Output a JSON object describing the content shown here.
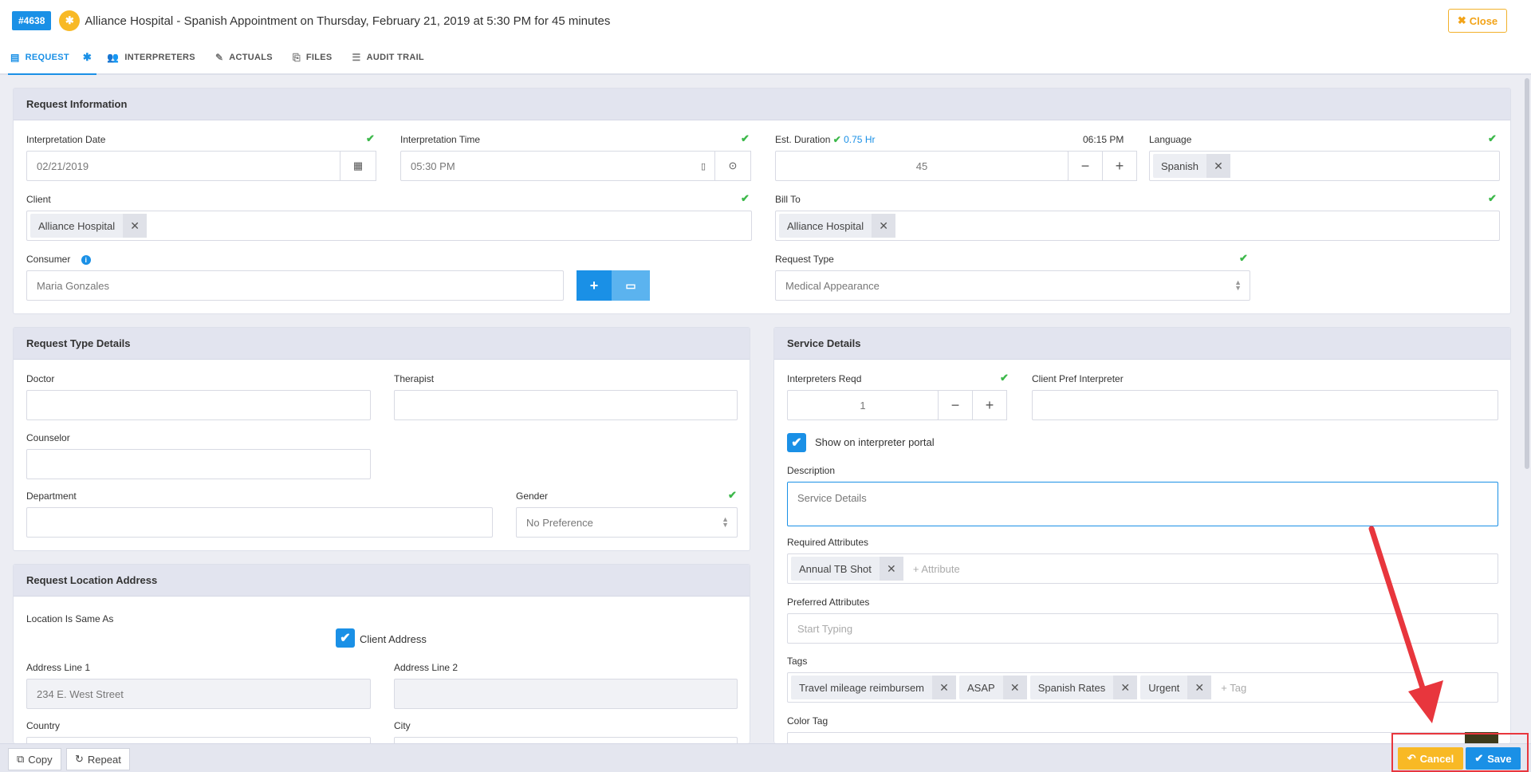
{
  "header": {
    "request_number": "#4638",
    "title": "Alliance Hospital  - Spanish Appointment on Thursday, February 21, 2019 at 5:30 PM for 45 minutes",
    "close_label": "Close"
  },
  "tabs": [
    {
      "label": "REQUEST",
      "icon": "form-icon"
    },
    {
      "label": "INTERPRETERS",
      "icon": "users-icon"
    },
    {
      "label": "ACTUALS",
      "icon": "edit-icon"
    },
    {
      "label": "FILES",
      "icon": "files-icon"
    },
    {
      "label": "AUDIT TRAIL",
      "icon": "list-icon"
    }
  ],
  "request_info": {
    "heading": "Request Information",
    "interpretation_date": {
      "label": "Interpretation Date",
      "value": "02/21/2019"
    },
    "interpretation_time": {
      "label": "Interpretation Time",
      "value": "05:30 PM"
    },
    "est_duration": {
      "label": "Est. Duration",
      "hours": "0.75 Hr",
      "end_time": "06:15 PM",
      "value": "45"
    },
    "language": {
      "label": "Language",
      "value": "Spanish"
    },
    "client": {
      "label": "Client",
      "value": "Alliance Hospital"
    },
    "bill_to": {
      "label": "Bill To",
      "value": "Alliance Hospital"
    },
    "consumer": {
      "label": "Consumer",
      "placeholder": "Maria Gonzales"
    },
    "request_type": {
      "label": "Request Type",
      "value": "Medical Appearance"
    }
  },
  "request_type_details": {
    "heading": "Request Type Details",
    "doctor_label": "Doctor",
    "therapist_label": "Therapist",
    "counselor_label": "Counselor",
    "department_label": "Department",
    "gender": {
      "label": "Gender",
      "value": "No Preference"
    }
  },
  "location": {
    "heading": "Request Location Address",
    "same_as_label": "Location Is Same As",
    "client_address_label": "Client Address",
    "address1": {
      "label": "Address Line 1",
      "value": "234 E. West Street"
    },
    "address2": {
      "label": "Address Line 2",
      "value": ""
    },
    "country_label": "Country",
    "city_label": "City"
  },
  "service_details": {
    "heading": "Service Details",
    "interpreters_reqd": {
      "label": "Interpreters Reqd",
      "value": "1"
    },
    "client_pref_label": "Client Pref Interpreter",
    "show_portal_label": "Show on interpreter portal",
    "description": {
      "label": "Description",
      "placeholder": "Service Details"
    },
    "required_attributes": {
      "label": "Required Attributes",
      "items": [
        "Annual TB Shot"
      ],
      "placeholder": "+ Attribute"
    },
    "preferred_attributes": {
      "label": "Preferred Attributes",
      "placeholder": "Start Typing"
    },
    "tags": {
      "label": "Tags",
      "items": [
        "Travel mileage reimbursem",
        "ASAP",
        "Spanish Rates",
        "Urgent"
      ],
      "placeholder": "+ Tag"
    },
    "color_tag_label": "Color Tag"
  },
  "footer": {
    "copy_label": "Copy",
    "repeat_label": "Repeat",
    "cancel_label": "Cancel",
    "save_label": "Save"
  },
  "colors": {
    "accent": "#1a90e6",
    "warning": "#f8b925",
    "success": "#3cb84a",
    "annotation": "#e8363d"
  }
}
